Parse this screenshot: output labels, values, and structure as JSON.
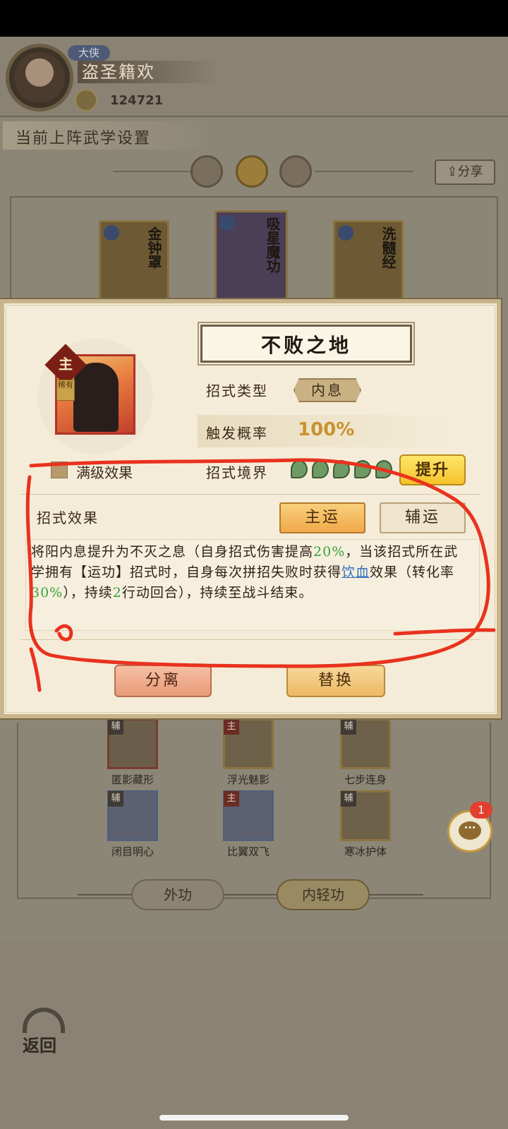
{
  "header": {
    "rank": "大侠",
    "player_name": "盗圣籍欢",
    "power": "124721"
  },
  "section_title": "当前上阵武学设置",
  "share_label": "分享",
  "top_cards": [
    {
      "name": "金钟罩"
    },
    {
      "name": "吸星魔功"
    },
    {
      "name": "洗髓经"
    }
  ],
  "modal": {
    "title": "不败之地",
    "main_tag": "主",
    "rare_tag": "稀有",
    "max_level_label": "满级效果",
    "type_label": "招式类型",
    "type_value": "内息",
    "prob_label": "触发概率",
    "prob_value": "100%",
    "realm_label": "招式境界",
    "realm_level": 5,
    "upgrade_label": "提升",
    "effect_label": "招式效果",
    "main_btn": "主运",
    "aux_btn": "辅运",
    "desc": {
      "p1": "将阳内息提升为不灭之息（自身招式伤害提高",
      "v1": "20%",
      "p2": "，当该招式所在武学拥有【运功】招式时，自身每次拼招失败时获得",
      "link": "饮血",
      "p3": "效果（转化率",
      "v2": "30%",
      "p4": "），持续",
      "v3": "2",
      "p5": "行动回合），持续至战斗结束。"
    },
    "separate_btn": "分离",
    "replace_btn": "替换"
  },
  "grid": [
    {
      "tag": "辅",
      "label": "匿影藏形"
    },
    {
      "tag": "主",
      "label": "浮光魅影"
    },
    {
      "tag": "辅",
      "label": "七步连身"
    },
    {
      "tag": "辅",
      "label": "闭目明心"
    },
    {
      "tag": "主",
      "label": "比翼双飞"
    },
    {
      "tag": "辅",
      "label": "寒冰护体"
    }
  ],
  "bottom_tabs": {
    "outer": "外功",
    "inner": "内轻功"
  },
  "back_label": "返回",
  "chat": {
    "badge_count": "1",
    "icon_text": "···"
  },
  "colors": {
    "annotation_red": "#e8321e",
    "accent_gold": "#f4c22a",
    "highlight_green": "#3aa33a"
  }
}
